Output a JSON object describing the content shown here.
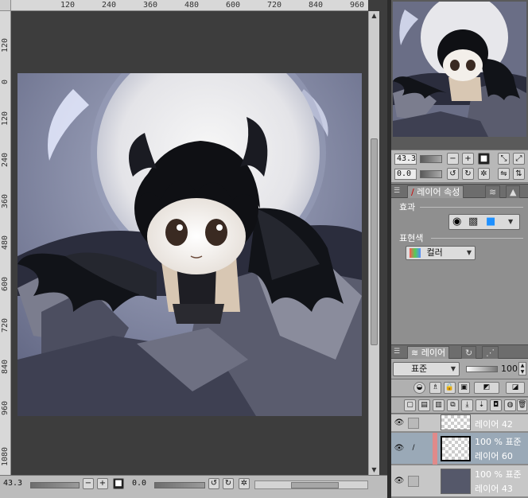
{
  "rulers": {
    "top": [
      "120",
      "240",
      "360",
      "480",
      "600",
      "720",
      "840",
      "960"
    ],
    "left": [
      "120",
      "0",
      "120",
      "240",
      "360",
      "480",
      "600",
      "720",
      "840",
      "960",
      "1080"
    ]
  },
  "bottom_bar": {
    "zoom": "43.3",
    "rotation": "0.0"
  },
  "navigator": {
    "zoom": "43.3",
    "rotation": "0.0"
  },
  "properties_panel": {
    "tab_label": "레이어 속성",
    "effect_label": "효과",
    "expression_label": "표현색",
    "expression_value": "컬러"
  },
  "layers_panel": {
    "tab_label": "레이어",
    "blend_mode": "표준",
    "opacity": "100",
    "layers": [
      {
        "name": "레이어 42",
        "info": "",
        "selected": false
      },
      {
        "name": "레이어 60",
        "info": "100 % 표준",
        "selected": true
      },
      {
        "name": "레이어 43",
        "info": "100 % 표준",
        "selected": false
      }
    ]
  }
}
